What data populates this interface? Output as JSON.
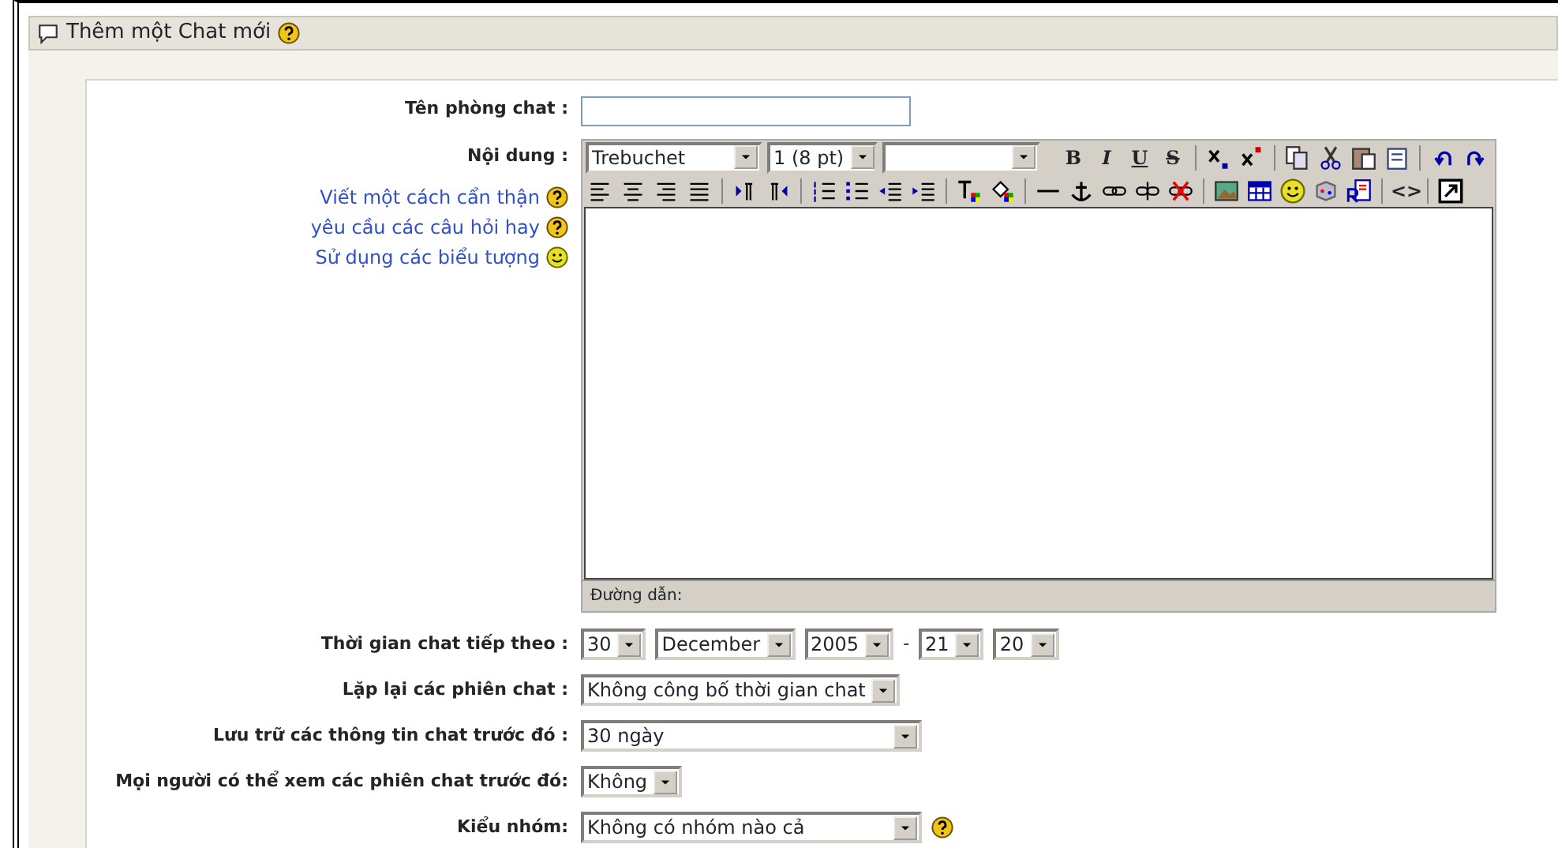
{
  "header": {
    "title": "Thêm một Chat mới"
  },
  "name_field": {
    "label": "Tên phòng chat :"
  },
  "content": {
    "label": "Nội dung :",
    "help_links": [
      {
        "text": "Viết một cách cẩn thận",
        "kind": "help"
      },
      {
        "text": "yêu cầu các câu hỏi hay",
        "kind": "help"
      },
      {
        "text": "Sử dụng các biểu tượng",
        "kind": "smiley"
      }
    ],
    "font_select": "Trebuchet",
    "size_select": "1 (8 pt)",
    "format_glyphs": [
      "B",
      "I",
      "U",
      "S"
    ],
    "source_glyph": "<>",
    "path_label": "Đường dẫn:"
  },
  "fields": [
    {
      "label": "Thời gian chat tiếp theo :",
      "selects": [
        {
          "value": "30"
        },
        {
          "value": "December"
        },
        {
          "value": "2005"
        },
        {
          "value": "21",
          "sep": "-"
        },
        {
          "value": "20"
        }
      ]
    },
    {
      "label": "Lặp lại các phiên chat :",
      "selects": [
        {
          "value": "Không công bố thời gian chat"
        }
      ]
    },
    {
      "label": "Lưu trữ các thông tin chat trước đó :",
      "selects": [
        {
          "value": "30 ngày",
          "wide": true
        }
      ]
    },
    {
      "label": "Mọi người có thể xem các phiên chat trước đó:",
      "selects": [
        {
          "value": "Không"
        }
      ]
    },
    {
      "label": "Kiểu nhóm:",
      "selects": [
        {
          "value": "Không có nhóm nào cả",
          "wide": true
        }
      ],
      "help": true
    }
  ]
}
